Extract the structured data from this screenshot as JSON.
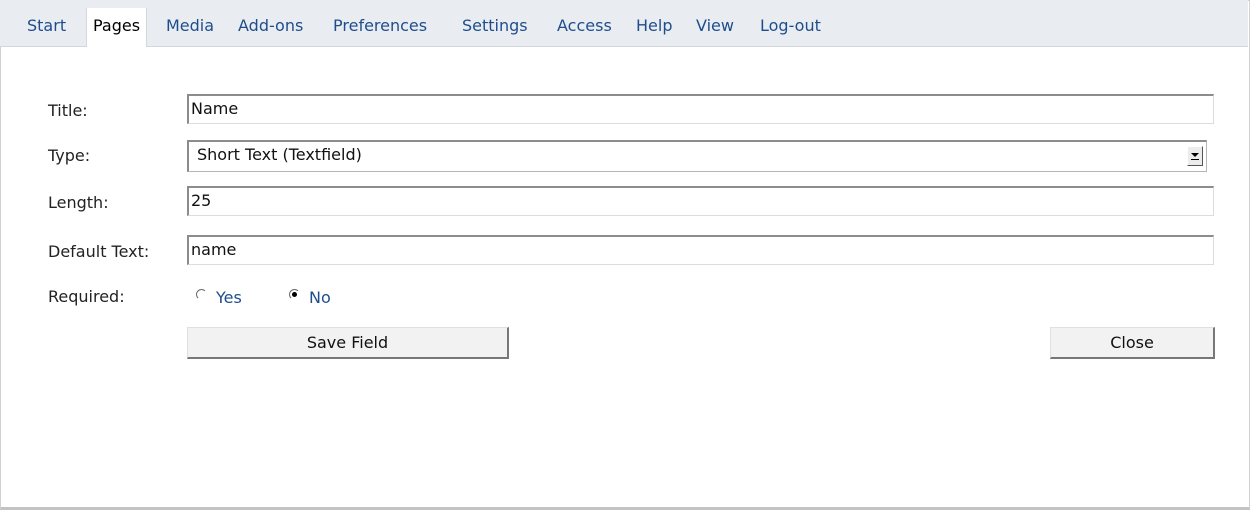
{
  "nav": {
    "items": [
      {
        "label": "Start"
      },
      {
        "label": "Pages"
      },
      {
        "label": "Media"
      },
      {
        "label": "Add-ons"
      },
      {
        "label": "Preferences"
      },
      {
        "label": "Settings"
      },
      {
        "label": "Access"
      },
      {
        "label": "Help"
      },
      {
        "label": "View"
      },
      {
        "label": "Log-out"
      }
    ],
    "active": "Pages"
  },
  "form": {
    "title_label": "Title:",
    "title_value": "Name",
    "type_label": "Type:",
    "type_value": "Short Text (Textfield)",
    "length_label": "Length:",
    "length_value": "25",
    "default_label": "Default Text:",
    "default_value": "name",
    "required_label": "Required:",
    "required_options": [
      "Yes",
      "No"
    ],
    "required_selected": "No",
    "save_label": "Save Field",
    "close_label": "Close"
  },
  "colors": {
    "nav_bg": "#e9edf1",
    "link": "#1f4d8c"
  },
  "icons": {
    "type_dropdown": "chevron-down-icon"
  }
}
